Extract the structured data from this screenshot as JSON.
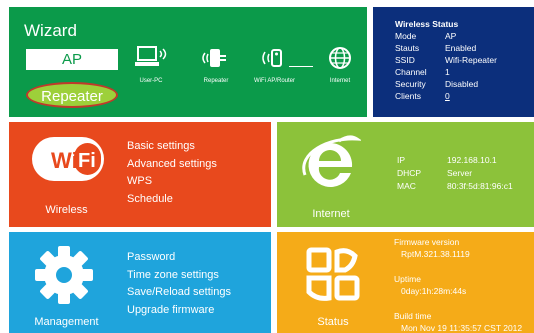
{
  "wizard": {
    "title": "Wizard",
    "ap_label": "AP",
    "repeater_label": "Repeater",
    "devices": {
      "user_pc": "User-PC",
      "repeater": "Repeater",
      "wifi_ap_router": "WiFi AP/Router",
      "internet": "Internet"
    }
  },
  "wireless_status": {
    "title": "Wireless Status",
    "rows": [
      {
        "key": "Mode",
        "value": "AP"
      },
      {
        "key": "Stauts",
        "value": "Enabled"
      },
      {
        "key": "SSID",
        "value": "Wifi-Repeater"
      },
      {
        "key": "Channel",
        "value": "1"
      },
      {
        "key": "Security",
        "value": "Disabled"
      },
      {
        "key": "Clients",
        "value": "0"
      }
    ]
  },
  "wireless": {
    "label": "Wireless",
    "logo_text": "Wi Fi",
    "menu": [
      "Basic settings",
      "Advanced settings",
      "WPS",
      "Schedule"
    ]
  },
  "internet": {
    "label": "Internet",
    "rows": [
      {
        "key": "IP",
        "value": "192.168.10.1"
      },
      {
        "key": "DHCP",
        "value": "Server"
      },
      {
        "key": "MAC",
        "value": "80:3f:5d:81:96:c1"
      }
    ]
  },
  "management": {
    "label": "Management",
    "menu": [
      "Password",
      "Time zone settings",
      "Save/Reload settings",
      "Upgrade firmware"
    ]
  },
  "status": {
    "label": "Status",
    "firmware_label": "Firmware version",
    "firmware_value": "RptM.321.38.1119",
    "uptime_label": "Uptime",
    "uptime_value": "0day:1h:28m:44s",
    "build_label": "Build time",
    "build_value": "Mon Nov 19 11:35:57 CST 2012"
  },
  "colors": {
    "wizard": "#0b9a4a",
    "wireless_status": "#0c2f7c",
    "wireless": "#e8491d",
    "internet": "#8cc23a",
    "management": "#1fa4dc",
    "status": "#f5ab18"
  }
}
